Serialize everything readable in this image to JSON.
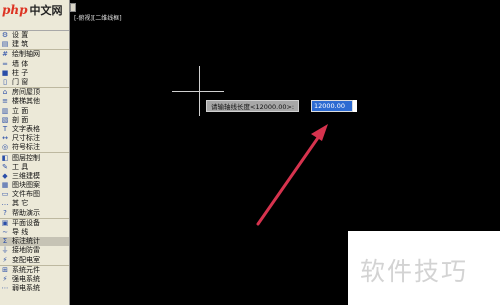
{
  "watermark": {
    "brand_latin": "php",
    "brand_cn": "中文网"
  },
  "canvas": {
    "title": "[-俯视][二维线框]"
  },
  "sidebar": {
    "items": [
      {
        "label": "设 置",
        "icon": "gear-icon",
        "glyph": "⚙"
      },
      {
        "label": "建 筑",
        "icon": "building-icon",
        "glyph": "▤"
      },
      {
        "label": "绘制轴网",
        "icon": "grid-icon",
        "glyph": "#",
        "sep": true
      },
      {
        "label": "墙 体",
        "icon": "wall-icon",
        "glyph": "═"
      },
      {
        "label": "柱 子",
        "icon": "column-icon",
        "glyph": "■"
      },
      {
        "label": "门 窗",
        "icon": "door-icon",
        "glyph": "▯"
      },
      {
        "label": "房间屋顶",
        "icon": "roof-icon",
        "glyph": "⌂",
        "sep": true
      },
      {
        "label": "楼梯其他",
        "icon": "stair-icon",
        "glyph": "≡"
      },
      {
        "label": "立 面",
        "icon": "elevation-icon",
        "glyph": "▥"
      },
      {
        "label": "剖 面",
        "icon": "section-icon",
        "glyph": "▧"
      },
      {
        "label": "文字表格",
        "icon": "text-icon",
        "glyph": "T"
      },
      {
        "label": "尺寸标注",
        "icon": "dimension-icon",
        "glyph": "↔"
      },
      {
        "label": "符号标注",
        "icon": "symbol-icon",
        "glyph": "◎"
      },
      {
        "label": "图层控制",
        "icon": "layer-icon",
        "glyph": "◧",
        "sep": true
      },
      {
        "label": "工 具",
        "icon": "tool-icon",
        "glyph": "✎"
      },
      {
        "label": "三维建模",
        "icon": "3d-icon",
        "glyph": "◆"
      },
      {
        "label": "图块图案",
        "icon": "block-icon",
        "glyph": "▦"
      },
      {
        "label": "文件布图",
        "icon": "file-icon",
        "glyph": "▭"
      },
      {
        "label": "其 它",
        "icon": "other-icon",
        "glyph": "…"
      },
      {
        "label": "帮助演示",
        "icon": "help-icon",
        "glyph": "?"
      },
      {
        "label": "平面设备",
        "icon": "device-icon",
        "glyph": "▣",
        "sep": true
      },
      {
        "label": "导 线",
        "icon": "wire-icon",
        "glyph": "∼"
      },
      {
        "label": "标注统计",
        "icon": "stats-icon",
        "glyph": "Σ",
        "active": true
      },
      {
        "label": "接地防雷",
        "icon": "ground-icon",
        "glyph": "⏚"
      },
      {
        "label": "变配电室",
        "icon": "substation-icon",
        "glyph": "⚡"
      },
      {
        "label": "系统元件",
        "icon": "component-icon",
        "glyph": "⊞",
        "sep": true
      },
      {
        "label": "强电系统",
        "icon": "power-icon",
        "glyph": "⚡"
      },
      {
        "label": "弱电系统",
        "icon": "lowvolt-icon",
        "glyph": "⋯"
      }
    ]
  },
  "dynamic_input": {
    "prompt": "请输轴线长度<12000.00>:",
    "value": "12000.00"
  },
  "branding": {
    "text": "软件技巧"
  },
  "colors": {
    "arrow": "#d6334e",
    "selection": "#2d6bd2"
  }
}
